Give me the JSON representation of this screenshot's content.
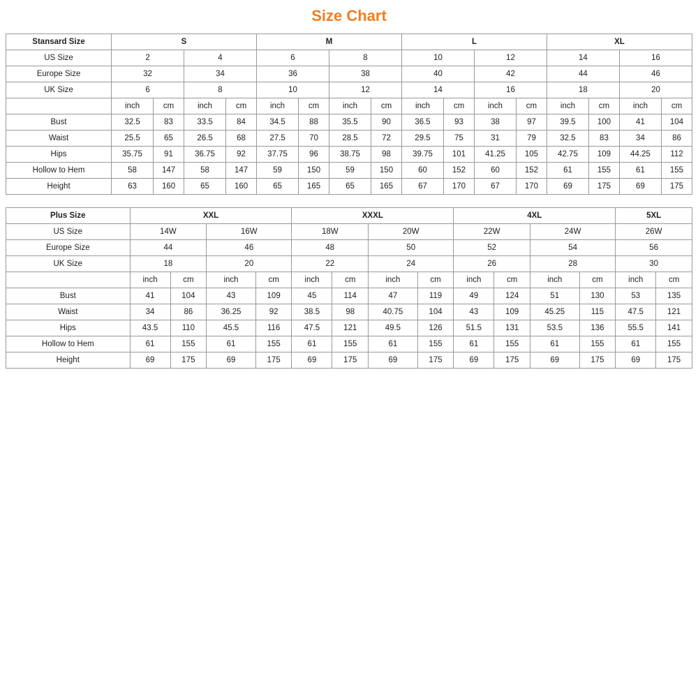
{
  "title": "Size Chart",
  "table1": {
    "headers": {
      "col1": "Stansard Size",
      "s": "S",
      "m": "M",
      "l": "L",
      "xl": "XL"
    },
    "usSize": {
      "label": "US Size",
      "values": [
        "2",
        "4",
        "6",
        "8",
        "10",
        "12",
        "14",
        "16"
      ]
    },
    "europeSize": {
      "label": "Europe Size",
      "values": [
        "32",
        "34",
        "36",
        "38",
        "40",
        "42",
        "44",
        "46"
      ]
    },
    "ukSize": {
      "label": "UK Size",
      "values": [
        "6",
        "8",
        "10",
        "12",
        "14",
        "16",
        "18",
        "20"
      ]
    },
    "unitHeader": [
      "inch",
      "cm",
      "inch",
      "cm",
      "inch",
      "cm",
      "inch",
      "cm",
      "inch",
      "cm",
      "inch",
      "cm",
      "inch",
      "cm",
      "inch",
      "cm"
    ],
    "bust": {
      "label": "Bust",
      "values": [
        "32.5",
        "83",
        "33.5",
        "84",
        "34.5",
        "88",
        "35.5",
        "90",
        "36.5",
        "93",
        "38",
        "97",
        "39.5",
        "100",
        "41",
        "104"
      ]
    },
    "waist": {
      "label": "Waist",
      "values": [
        "25.5",
        "65",
        "26.5",
        "68",
        "27.5",
        "70",
        "28.5",
        "72",
        "29.5",
        "75",
        "31",
        "79",
        "32.5",
        "83",
        "34",
        "86"
      ]
    },
    "hips": {
      "label": "Hips",
      "values": [
        "35.75",
        "91",
        "36.75",
        "92",
        "37.75",
        "96",
        "38.75",
        "98",
        "39.75",
        "101",
        "41.25",
        "105",
        "42.75",
        "109",
        "44.25",
        "112"
      ]
    },
    "hollowToHem": {
      "label": "Hollow to Hem",
      "values": [
        "58",
        "147",
        "58",
        "147",
        "59",
        "150",
        "59",
        "150",
        "60",
        "152",
        "60",
        "152",
        "61",
        "155",
        "61",
        "155"
      ]
    },
    "height": {
      "label": "Height",
      "values": [
        "63",
        "160",
        "65",
        "160",
        "65",
        "165",
        "65",
        "165",
        "67",
        "170",
        "67",
        "170",
        "69",
        "175",
        "69",
        "175"
      ]
    }
  },
  "table2": {
    "headers": {
      "col1": "Plus Size",
      "xxl": "XXL",
      "xxxl": "XXXL",
      "fourxl": "4XL",
      "fivexl": "5XL"
    },
    "usSize": {
      "label": "US Size",
      "values": [
        "14W",
        "16W",
        "18W",
        "20W",
        "22W",
        "24W",
        "26W"
      ]
    },
    "europeSize": {
      "label": "Europe Size",
      "values": [
        "44",
        "46",
        "48",
        "50",
        "52",
        "54",
        "56"
      ]
    },
    "ukSize": {
      "label": "UK Size",
      "values": [
        "18",
        "20",
        "22",
        "24",
        "26",
        "28",
        "30"
      ]
    },
    "unitHeader": [
      "inch",
      "cm",
      "inch",
      "cm",
      "inch",
      "cm",
      "inch",
      "cm",
      "inch",
      "cm",
      "inch",
      "cm",
      "inch",
      "cm"
    ],
    "bust": {
      "label": "Bust",
      "values": [
        "41",
        "104",
        "43",
        "109",
        "45",
        "114",
        "47",
        "119",
        "49",
        "124",
        "51",
        "130",
        "53",
        "135"
      ]
    },
    "waist": {
      "label": "Waist",
      "values": [
        "34",
        "86",
        "36.25",
        "92",
        "38.5",
        "98",
        "40.75",
        "104",
        "43",
        "109",
        "45.25",
        "115",
        "47.5",
        "121"
      ]
    },
    "hips": {
      "label": "Hips",
      "values": [
        "43.5",
        "110",
        "45.5",
        "116",
        "47.5",
        "121",
        "49.5",
        "126",
        "51.5",
        "131",
        "53.5",
        "136",
        "55.5",
        "141"
      ]
    },
    "hollowToHem": {
      "label": "Hollow to Hem",
      "values": [
        "61",
        "155",
        "61",
        "155",
        "61",
        "155",
        "61",
        "155",
        "61",
        "155",
        "61",
        "155",
        "61",
        "155"
      ]
    },
    "height": {
      "label": "Height",
      "values": [
        "69",
        "175",
        "69",
        "175",
        "69",
        "175",
        "69",
        "175",
        "69",
        "175",
        "69",
        "175",
        "69",
        "175"
      ]
    }
  }
}
